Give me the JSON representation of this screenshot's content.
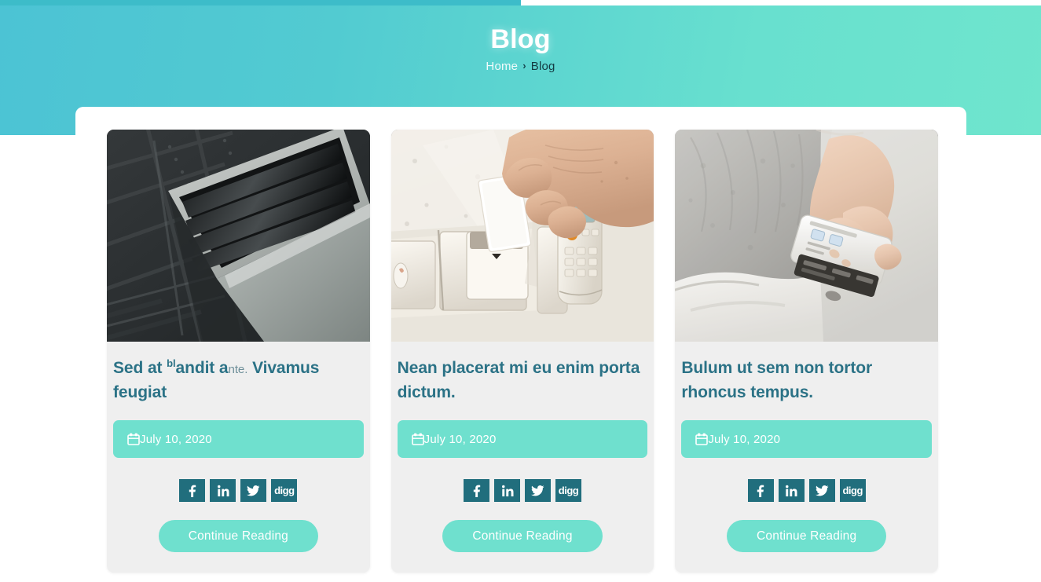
{
  "progress": {
    "percent": 50,
    "fill_color": "#3dbcc9"
  },
  "hero": {
    "title": "Blog",
    "gradient_from": "#4cc3d4",
    "gradient_to": "#6fe5cd",
    "breadcrumb": {
      "home_label": "Home",
      "separator": "›",
      "current_label": "Blog"
    }
  },
  "theme": {
    "accent_mint": "#6fe0ce",
    "title_color": "#2b7286",
    "social_color": "#216e7d",
    "card_bg": "#efefef"
  },
  "icons": {
    "calendar": "calendar-icon",
    "facebook": "facebook-icon",
    "linkedin": "linkedin-icon",
    "twitter": "twitter-icon",
    "digg": "digg-icon"
  },
  "social": {
    "facebook_label": "f",
    "linkedin_label": "in",
    "twitter_label": "twitter",
    "digg_label": "digg"
  },
  "posts": [
    {
      "image_alt": "dark ceiling air vent diffuser",
      "title_parts": {
        "lead": "Sed at ",
        "sup": "bl",
        "mid": "andit a",
        "tiny": "nte.",
        "tail": " Vivamus feugiat"
      },
      "title_plain": "Sed at blandit ante. Vivamus feugiat",
      "date": "July 10, 2020",
      "read_more_label": "Continue Reading"
    },
    {
      "image_alt": "hand inserting keycard into wall slot next to cordless phone",
      "title_parts": {
        "lead": "Nean placerat mi eu enim porta dictum.",
        "sup": "",
        "mid": "",
        "tiny": "",
        "tail": ""
      },
      "title_plain": "Nean placerat mi eu enim porta dictum.",
      "date": "July 10, 2020",
      "read_more_label": "Continue Reading"
    },
    {
      "image_alt": "person in gray shirt holding air conditioner remote control",
      "title_parts": {
        "lead": "Bulum ut sem non tortor rhoncus tempus.",
        "sup": "",
        "mid": "",
        "tiny": "",
        "tail": ""
      },
      "title_plain": "Bulum ut sem non tortor rhoncus tempus.",
      "date": "July 10, 2020",
      "read_more_label": "Continue Reading"
    }
  ]
}
